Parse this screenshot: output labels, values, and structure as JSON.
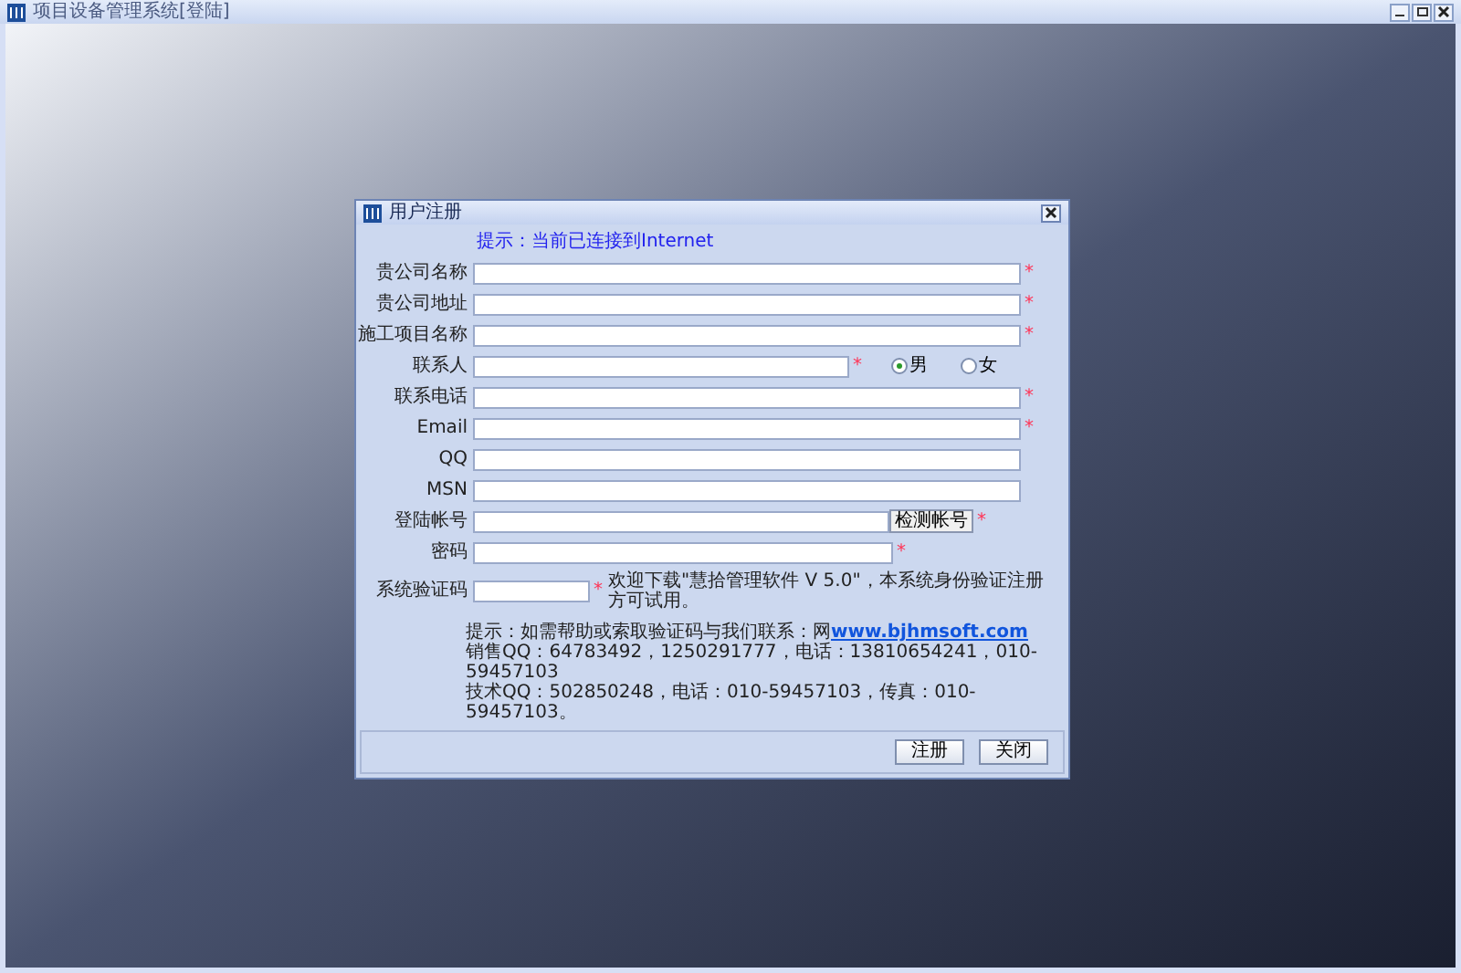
{
  "window": {
    "title": "项目设备管理系统[登陆]"
  },
  "dialog": {
    "title": "用户注册",
    "hint": "提示：当前已连接到Internet",
    "fields": [
      {
        "kind": "text",
        "label": "贵公司名称",
        "mark": "*"
      },
      {
        "kind": "text",
        "label": "贵公司地址",
        "mark": "*"
      },
      {
        "kind": "text",
        "label": "施工项目名称",
        "mark": "*"
      },
      {
        "kind": "gender",
        "label": "联系人",
        "mark": "*",
        "options": [
          {
            "label": "男",
            "selected": true
          },
          {
            "label": "女",
            "selected": false
          }
        ]
      },
      {
        "kind": "text",
        "label": "联系电话",
        "mark": "*"
      },
      {
        "kind": "text",
        "label": "Email",
        "mark": "*"
      },
      {
        "kind": "text",
        "label": "QQ"
      },
      {
        "kind": "text",
        "label": "MSN"
      },
      {
        "kind": "button",
        "label": "登陆帐号",
        "mark": "*",
        "button": "检测帐号"
      },
      {
        "kind": "password",
        "label": "密码",
        "mark": "*"
      },
      {
        "kind": "note",
        "label": "系统验证码",
        "mark": "*",
        "note": "欢迎下载\"慧拾管理软件 V 5.0\"，本系统身份验证注册方可试用。"
      }
    ],
    "footer": [
      {
        "text": "提示：如需帮助或索取验证码与我们联系：网",
        "link": "www.bjhmsoft.com"
      },
      {
        "text": "销售QQ：64783492，1250291777，电话：13810654241，010-59457103"
      },
      {
        "text": "技术QQ：502850248，电话：010-59457103，传真：010-59457103。"
      }
    ],
    "buttons": [
      "注册",
      "关闭"
    ]
  }
}
